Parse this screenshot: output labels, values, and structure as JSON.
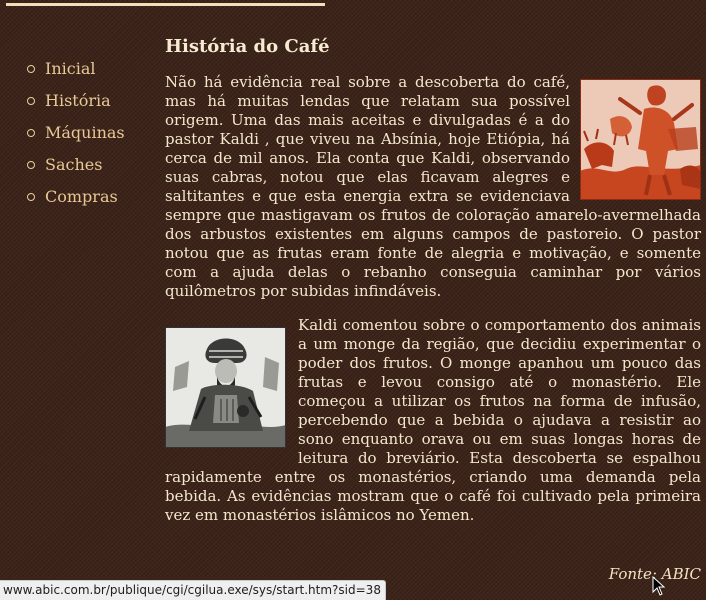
{
  "nav": {
    "items": [
      {
        "label": "Inicial"
      },
      {
        "label": "História"
      },
      {
        "label": "Máquinas"
      },
      {
        "label": "Saches"
      },
      {
        "label": "Compras"
      }
    ]
  },
  "article": {
    "title": "História do Café",
    "paragraphs": [
      "Não há evidência real sobre a descoberta do café, mas há muitas lendas que relatam sua possível origem. Uma das mais aceitas e divulgadas é a do pastor Kaldi , que viveu na Absínia, hoje Etiópia, há cerca de mil anos. Ela conta que Kaldi, observando suas cabras, notou que elas ficavam alegres e saltitantes e que esta energia extra se evidenciava sempre que mastigavam os frutos de coloração amarelo-avermelhada dos arbustos existentes em alguns campos de pastoreio. O pastor notou que as frutas eram fonte de alegria e motivação, e somente com a ajuda delas o rebanho conseguia caminhar por vários quilômetros por subidas infindáveis.",
      "Kaldi comentou sobre o comportamento dos animais a um monge da região, que decidiu experimentar o poder dos frutos. O monge apanhou um pouco das frutas e levou consigo até o monastério. Ele começou a utilizar os frutos na forma de infusão, percebendo que a bebida o ajudava a resistir ao sono enquanto orava ou em suas longas horas de leitura do breviário. Esta descoberta se espalhou rapidamente entre os monastérios, criando uma demanda pela bebida. As evidências mostram que o café foi cultivado pela primeira vez em monastérios islâmicos no Yemen."
    ],
    "source": "Fonte: ABIC"
  },
  "statusbar": {
    "url": "www.abic.com.br/publique/cgi/cgilua.exe/sys/start.htm?sid=38"
  },
  "colors": {
    "background": "#3b2218",
    "text": "#f4e7cc",
    "nav_link": "#e7c996"
  },
  "icons": {
    "cursor": "mouse-pointer-icon"
  }
}
